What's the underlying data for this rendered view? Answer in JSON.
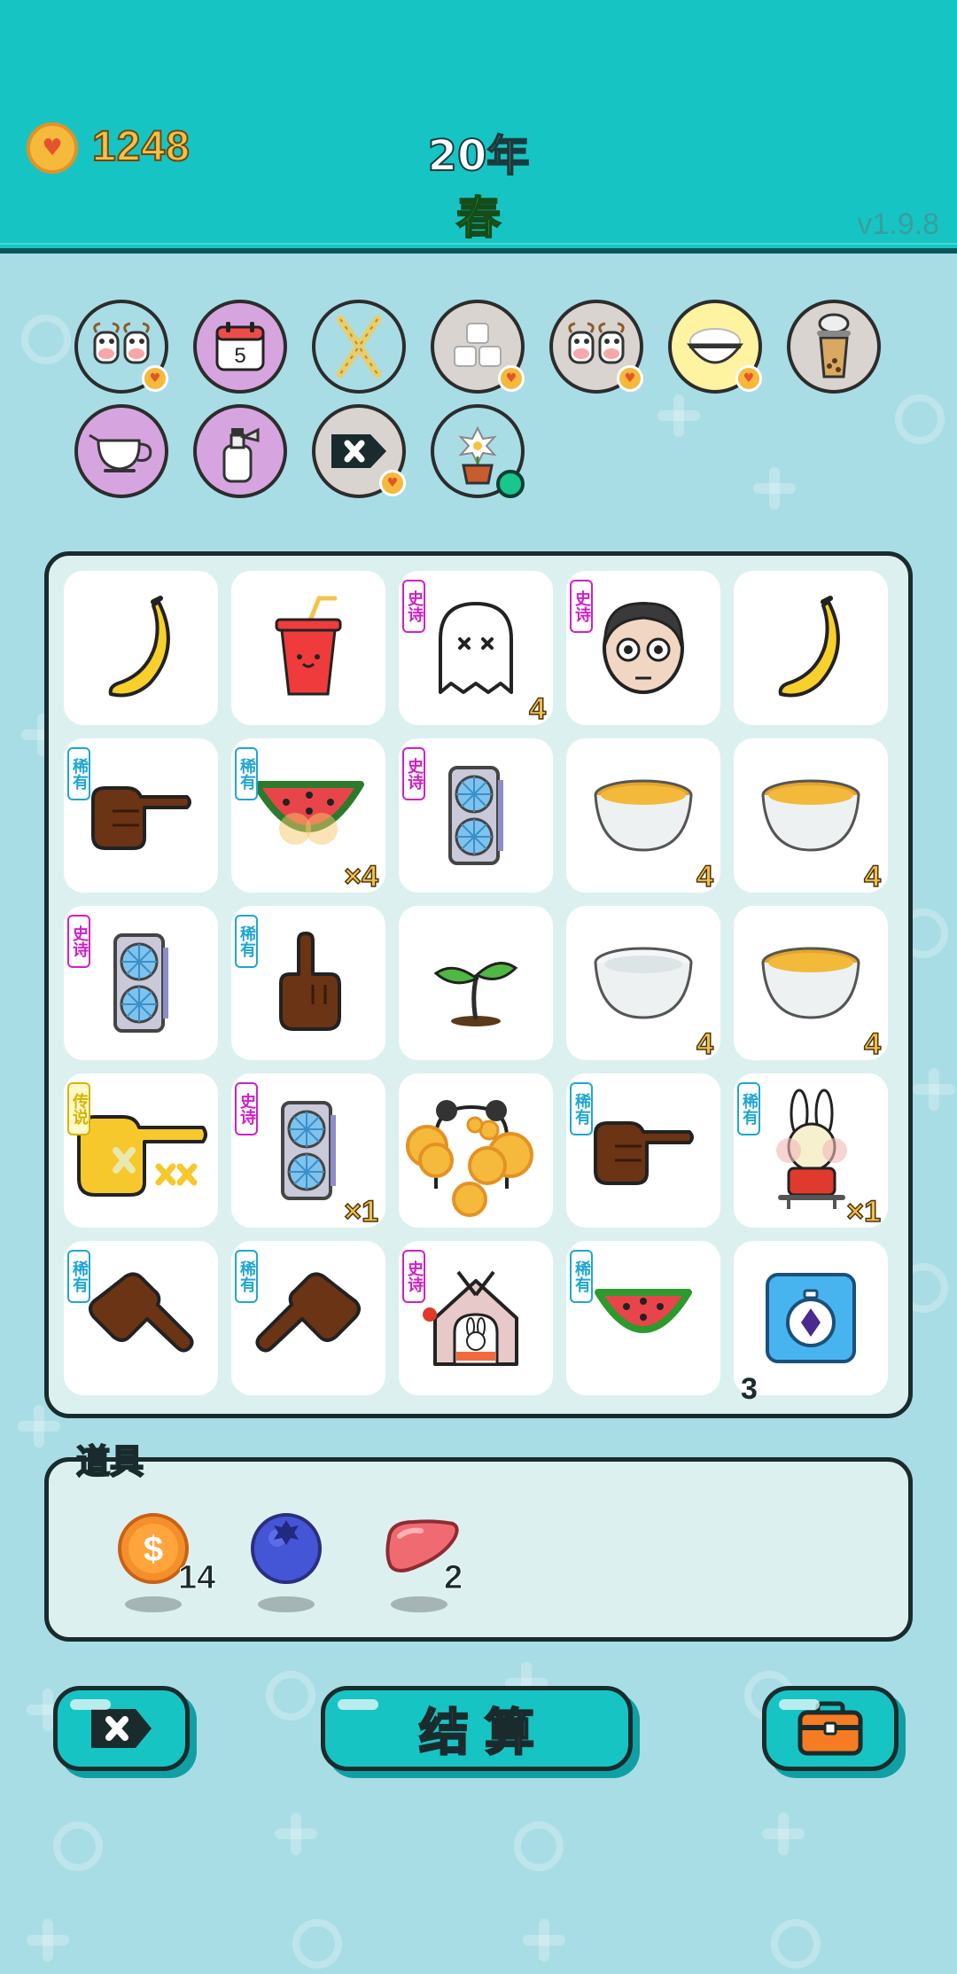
{
  "header": {
    "coins": "1248",
    "year": "20年",
    "season": "春",
    "version": "v1.9.8"
  },
  "status_icons": [
    {
      "name": "cows-icon",
      "bg": "#a9dde6",
      "mark": "heart"
    },
    {
      "name": "calendar-icon",
      "bg": "#d6a5e0",
      "text": "5"
    },
    {
      "name": "crossed-sticks-icon",
      "bg": "#a9dde6"
    },
    {
      "name": "sugar-cubes-icon",
      "bg": "#d9d4cf",
      "mark": "heart"
    },
    {
      "name": "cows-icon-2",
      "bg": "#d9d4cf",
      "mark": "heart"
    },
    {
      "name": "rice-bowl-icon",
      "bg": "#fdf3a0",
      "mark": "heart"
    },
    {
      "name": "bubble-tea-icon",
      "bg": "#d9d4cf"
    },
    {
      "name": "milk-jug-icon",
      "bg": "#d6a5e0"
    },
    {
      "name": "spray-bottle-icon",
      "bg": "#d6a5e0"
    },
    {
      "name": "remove-tag-icon",
      "bg": "#d9d4cf",
      "mark": "heart"
    },
    {
      "name": "potted-flower-icon",
      "bg": "#a9dde6",
      "mark": "dot"
    }
  ],
  "board": {
    "badges": {
      "rare": "稀有",
      "epic": "史诗",
      "legend": "传说"
    },
    "cells": [
      {
        "item": "banana",
        "badge": "",
        "count": ""
      },
      {
        "item": "drink-cup",
        "badge": "",
        "count": ""
      },
      {
        "item": "ghost",
        "badge": "epic",
        "count": "4"
      },
      {
        "item": "man-face",
        "badge": "epic",
        "count": ""
      },
      {
        "item": "banana",
        "badge": "",
        "count": ""
      },
      {
        "item": "point-right-hand",
        "badge": "rare",
        "count": ""
      },
      {
        "item": "watermelon",
        "badge": "rare",
        "count": "×4"
      },
      {
        "item": "graphics-card",
        "badge": "epic",
        "count": ""
      },
      {
        "item": "tea-bowl",
        "badge": "",
        "count": "4"
      },
      {
        "item": "tea-bowl",
        "badge": "",
        "count": "4"
      },
      {
        "item": "graphics-card",
        "badge": "epic",
        "count": ""
      },
      {
        "item": "point-up-hand",
        "badge": "rare",
        "count": ""
      },
      {
        "item": "sprout",
        "badge": "",
        "count": ""
      },
      {
        "item": "empty-bowl",
        "badge": "",
        "count": "4"
      },
      {
        "item": "tea-bowl",
        "badge": "",
        "count": "4"
      },
      {
        "item": "golden-hand",
        "badge": "legend",
        "count": ""
      },
      {
        "item": "graphics-card",
        "badge": "epic",
        "count": "×1"
      },
      {
        "item": "panda-coins",
        "badge": "",
        "count": ""
      },
      {
        "item": "point-right-hand",
        "badge": "rare",
        "count": ""
      },
      {
        "item": "bunny",
        "badge": "rare",
        "count": "×1"
      },
      {
        "item": "point-down-right-hand",
        "badge": "rare",
        "count": ""
      },
      {
        "item": "point-down-left-hand",
        "badge": "rare",
        "count": ""
      },
      {
        "item": "bunny-house",
        "badge": "epic",
        "count": ""
      },
      {
        "item": "watermelon-slice",
        "badge": "rare",
        "count": ""
      },
      {
        "item": "stopwatch-card",
        "badge": "",
        "count": ""
      }
    ],
    "stopwatch_count": "3"
  },
  "items": {
    "title": "道具",
    "list": [
      {
        "name": "dollar-coin-icon",
        "count": "14"
      },
      {
        "name": "blueberry-icon",
        "count": ""
      },
      {
        "name": "liver-icon",
        "count": "2"
      }
    ]
  },
  "buttons": {
    "remove": "remove-tag-icon",
    "settle": "结算",
    "bag": "briefcase-icon"
  },
  "colors": {
    "header": "#17c4c4",
    "background": "#a9dde6",
    "coin_text": "#f5c047",
    "season": "#2bd63a",
    "rare": "#1ea6d4",
    "epic": "#d020c8",
    "legend": "#d6b400"
  }
}
